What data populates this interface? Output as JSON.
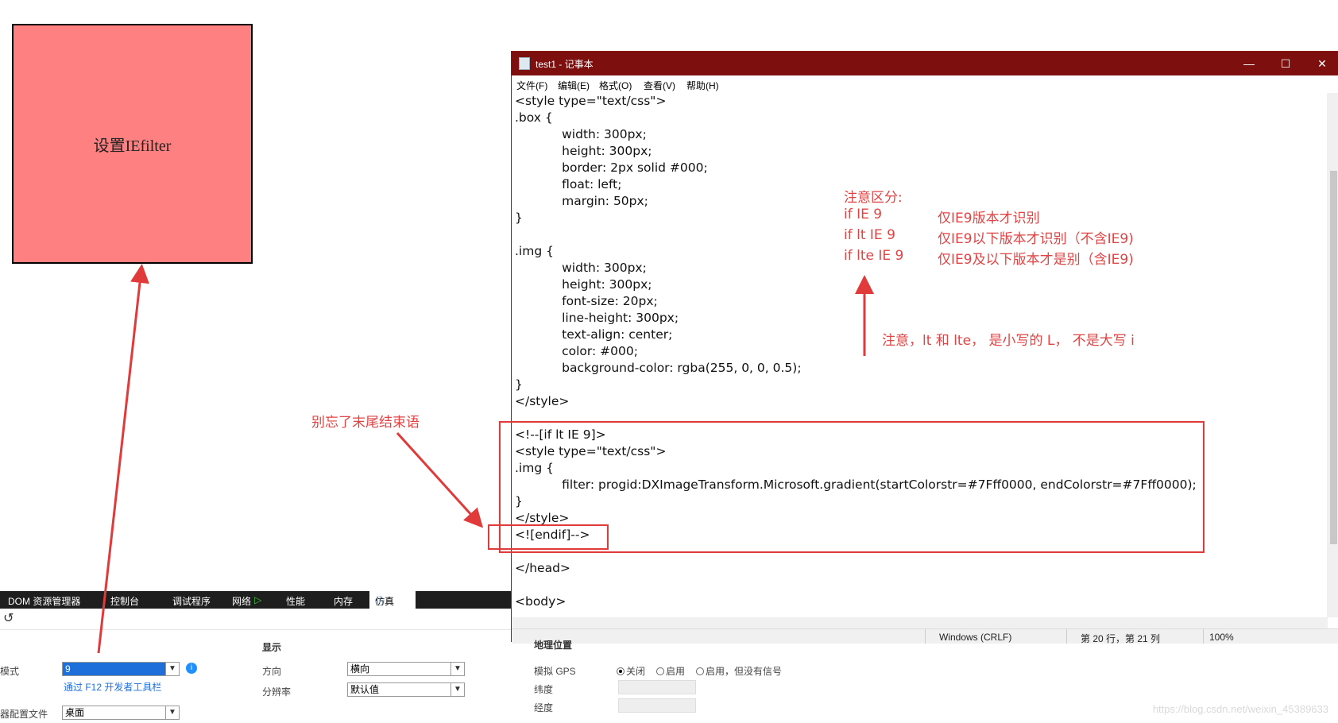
{
  "demo_box": {
    "text": "设置IEfilter"
  },
  "notepad": {
    "title": "test1 - 记事本",
    "menu": [
      "文件(F)",
      "编辑(E)",
      "格式(O)",
      "查看(V)",
      "帮助(H)"
    ],
    "lines": [
      "<style type=\"text/css\">",
      ".box {",
      "            width: 300px;",
      "            height: 300px;",
      "            border: 2px solid #000;",
      "            float: left;",
      "            margin: 50px;",
      "}",
      "",
      ".img {",
      "            width: 300px;",
      "            height: 300px;",
      "            font-size: 20px;",
      "            line-height: 300px;",
      "            text-align: center;",
      "            color: #000;",
      "            background-color: rgba(255, 0, 0, 0.5);",
      "}",
      "</style>",
      "",
      "<!--[if lt IE 9]>",
      "<style type=\"text/css\">",
      ".img {",
      "            filter: progid:DXImageTransform.Microsoft.gradient(startColorstr=#7Fff0000, endColorstr=#7Fff0000);",
      "}",
      "</style>",
      "<![endif]-->",
      "",
      "</head>",
      "",
      "<body>"
    ],
    "status": {
      "eol": "Windows (CRLF)",
      "position": "第 20 行，第 21 列",
      "zoom": "100%"
    }
  },
  "annotations": {
    "note_title": "注意区分:",
    "rules": [
      {
        "cond": "if IE 9",
        "desc": "仅IE9版本才识别"
      },
      {
        "cond": "if lt IE 9",
        "desc": "仅IE9以下版本才识别（不含IE9)"
      },
      {
        "cond": "if lte IE 9",
        "desc": "仅IE9及以下版本才是别（含IE9)"
      }
    ],
    "case_note": "注意，lt 和 lte， 是小写的 L， 不是大写 i",
    "ending_note": "别忘了末尾结束语"
  },
  "devtools": {
    "tabs": [
      "DOM 资源管理器",
      "控制台",
      "调试程序",
      "网络",
      "性能",
      "内存",
      "仿真"
    ],
    "mode_label": "模式",
    "mode_value": "9",
    "mode_link": "通过 F12 开发者工具栏",
    "profile_label": "器配置文件",
    "profile_value": "桌面",
    "display_header": "显示",
    "orientation_label": "方向",
    "orientation_value": "横向",
    "resolution_label": "分辨率",
    "resolution_value": "默认值",
    "geo_header": "地理位置",
    "gps_label": "模拟 GPS",
    "gps_options": [
      "关闭",
      "启用",
      "启用，但没有信号"
    ],
    "lat_label": "纬度",
    "lon_label": "经度"
  },
  "watermark": "https://blog.csdn.net/weixin_45389633",
  "colors": {
    "annotation_red": "#e03a3a",
    "titlebar": "#7d0f0f",
    "box_fill": "#ff8080"
  }
}
